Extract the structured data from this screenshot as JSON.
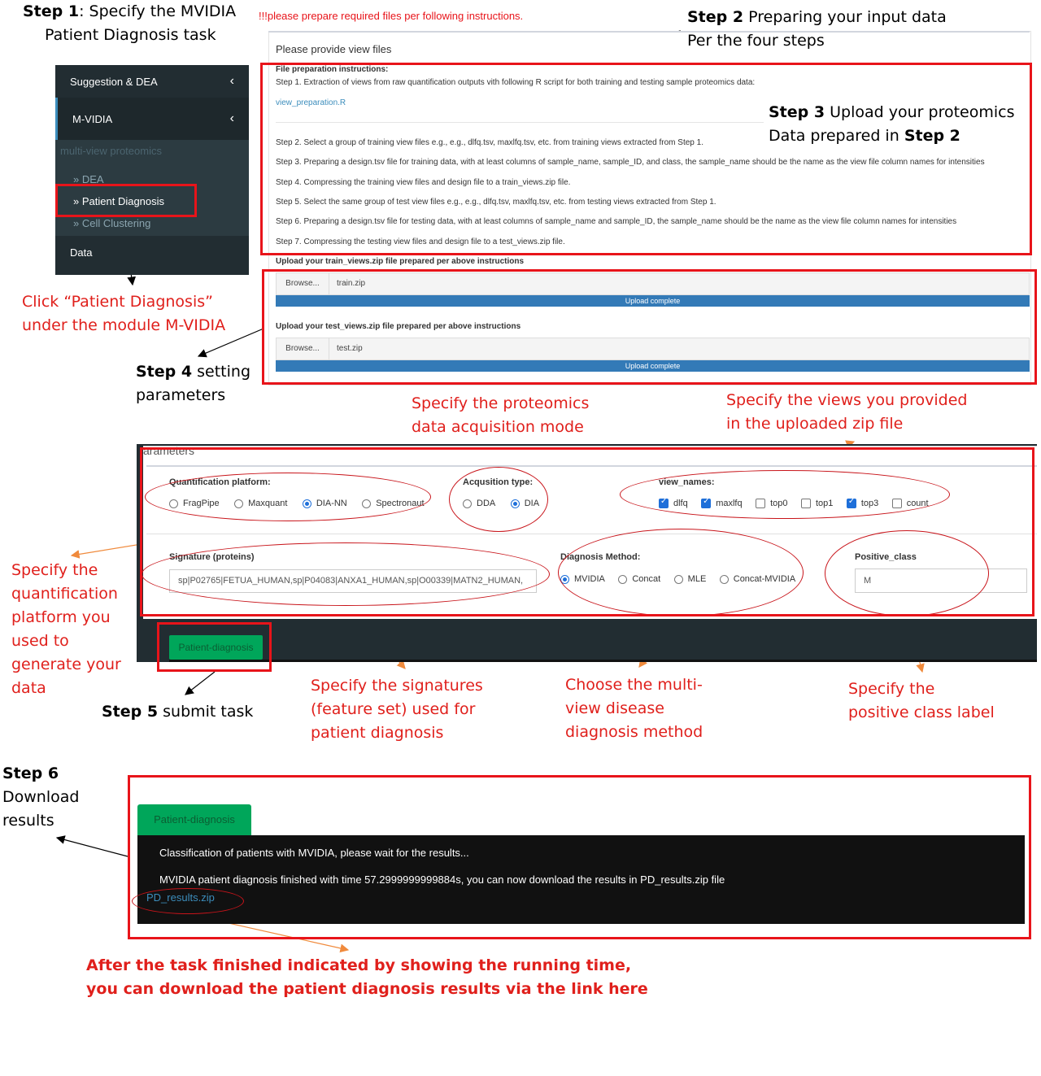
{
  "annotations": {
    "step1_bold": "Step 1",
    "step1_text": ": Specify the MVIDIA",
    "step1_line2": "Patient Diagnosis task",
    "click_line1": "Click  “Patient Diagnosis”",
    "click_line2": "under the module M-VIDIA",
    "step2_bold": "Step 2",
    "step2_text": " Preparing your input data",
    "step2_line2": "Per the four steps",
    "step3_bold": "Step 3",
    "step3_text": " Upload your proteomics",
    "step3_line2a": "Data prepared in ",
    "step3_line2b": "Step 2",
    "step4_bold": "Step 4",
    "step4_text": " setting",
    "step4_line2": "parameters",
    "acq_line1": "Specify the proteomics",
    "acq_line2": "data acquisition mode",
    "views_line1": "Specify the views you provided",
    "views_line2": "in  the uploaded zip file",
    "quant_lines": [
      "Specify the",
      "quantification",
      "platform you",
      "used to",
      "generate your",
      "data"
    ],
    "step5_bold": "Step 5",
    "step5_text": " submit task",
    "sig_lines": [
      "Specify the signatures",
      "(feature set) used for",
      "patient diagnosis"
    ],
    "method_lines": [
      "Choose the multi-",
      "view disease",
      "diagnosis method"
    ],
    "pos_lines": [
      "Specify the",
      "positive class label"
    ],
    "step6_bold": "Step 6",
    "step6_lines": [
      "Download",
      "results"
    ],
    "final_line1": "After the task finished indicated by showing the running time,",
    "final_line2": "you can download the patient diagnosis results via the link here"
  },
  "sidebar": {
    "suggestion": "Suggestion & DEA",
    "mvidia": "M-VIDIA",
    "caption": "multi-view proteomics",
    "items": [
      {
        "label": "DEA"
      },
      {
        "label": "Patient Diagnosis"
      },
      {
        "label": "Cell Clustering"
      }
    ],
    "data": "Data"
  },
  "files_panel": {
    "warning": "!!!please prepare required files per following instructions.",
    "title": "Please provide view files",
    "instr_title": "File preparation instructions:",
    "step1": "Step 1. Extraction of views from raw quantification outputs vith following R script for both training and testing sample proteomics data:",
    "link": "view_preparation.R",
    "step2": "Step 2. Select a group of training view files e.g., e.g., dlfq.tsv, maxlfq.tsv, etc. from training views extracted from Step 1.",
    "step3": "Step 3. Preparing a design.tsv file for training data, with at least columns of sample_name, sample_ID, and class, the sample_name should be the name as the view file column names for intensities",
    "step4": "Step 4. Compressing the training view files and design file to a train_views.zip file.",
    "step5": "Step 5. Select the same group of test view files e.g., e.g., dlfq.tsv, maxlfq.tsv, etc. from testing views extracted from Step 1.",
    "step6": "Step 6. Preparing a design.tsv file for testing data, with at least columns of sample_name and sample_ID, the sample_name should be the name as the view file column names for intensities",
    "step7": "Step 7. Compressing the testing view files and design file to a test_views.zip file.",
    "train_label": "Upload your train_views.zip file prepared per above instructions",
    "train_browse": "Browse...",
    "train_file": "train.zip",
    "train_status": "Upload complete",
    "test_label": "Upload your test_views.zip file prepared per above instructions",
    "test_browse": "Browse...",
    "test_file": "test.zip",
    "test_status": "Upload complete"
  },
  "params": {
    "header": "arameters",
    "quant_label": "Quantification platform:",
    "quant_options": [
      "FragPipe",
      "Maxquant",
      "DIA-NN",
      "Spectronaut"
    ],
    "quant_selected": "DIA-NN",
    "acq_label": "Acqusition type:",
    "acq_options": [
      "DDA",
      "DIA"
    ],
    "acq_selected": "DIA",
    "views_label": "view_names:",
    "views_options": [
      "dlfq",
      "maxlfq",
      "top0",
      "top1",
      "top3",
      "count"
    ],
    "views_checked": [
      "dlfq",
      "maxlfq",
      "top3"
    ],
    "sig_label": "Signature (proteins)",
    "sig_value": "sp|P02765|FETUA_HUMAN,sp|P04083|ANXA1_HUMAN,sp|O00339|MATN2_HUMAN,",
    "method_label": "Diagnosis Method:",
    "method_options": [
      "MVIDIA",
      "Concat",
      "MLE",
      "Concat-MVIDIA"
    ],
    "method_selected": "MVIDIA",
    "pos_label": "Positive_class",
    "pos_value": "M",
    "submit": "Patient-diagnosis"
  },
  "results": {
    "button": "Patient-diagnosis",
    "line1": "Classification of patients with MVIDIA, please wait for the results...",
    "line2": "MVIDIA patient diagnosis finished with time 57.2999999999884s, you can now download the results in PD_results.zip file",
    "link": "PD_results.zip"
  },
  "colors": {
    "annotation_red": "#e0201c",
    "box_red": "#e8141a",
    "green": "#00a65a",
    "blue_bar": "#337ab7",
    "sidebar_bg": "#222d32"
  }
}
